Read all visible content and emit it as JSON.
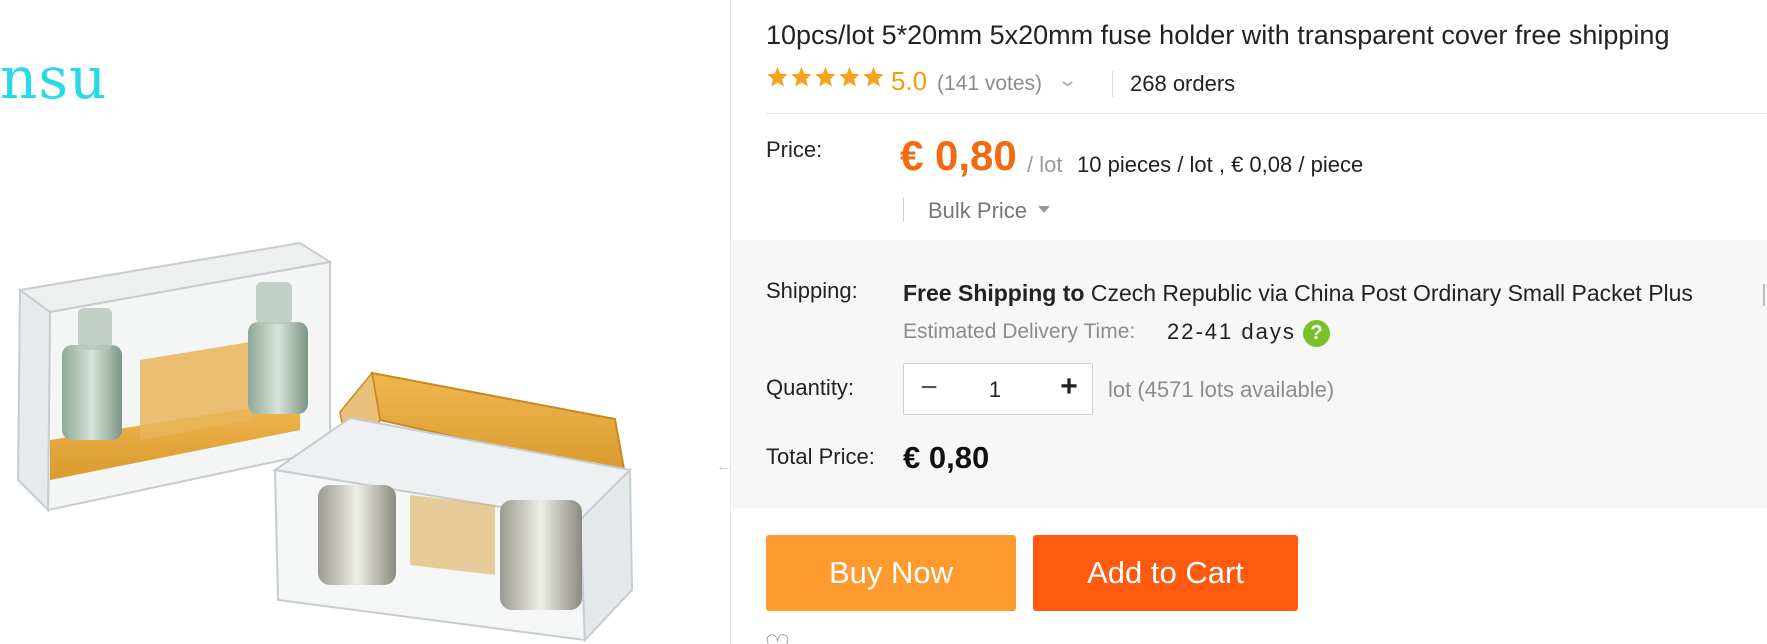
{
  "image": {
    "brand_watermark": "nsu",
    "arrow": "←",
    "alt_icon": "fuse-holder-photo"
  },
  "product": {
    "title": "10pcs/lot 5*20mm 5x20mm fuse holder with transparent cover free shipping",
    "rating": {
      "stars": 5,
      "value": "5.0",
      "votes": "(141 votes)",
      "chevron": "⌄"
    },
    "orders": "268 orders"
  },
  "price": {
    "label": "Price:",
    "value": "€ 0,80",
    "unit": "/ lot",
    "detail": "10 pieces / lot , € 0,08 / piece",
    "bulk_label": "Bulk Price"
  },
  "shipping": {
    "label": "Shipping:",
    "free_text": "Free Shipping",
    "to_text": "to",
    "destination_text": "Czech Republic via China Post Ordinary Small Packet Plus",
    "delivery_label": "Estimated Delivery Time:",
    "delivery_value": "22-41 days",
    "help_icon": "?"
  },
  "quantity": {
    "label": "Quantity:",
    "minus": "−",
    "value": "1",
    "plus": "+",
    "available": "lot (4571 lots available)"
  },
  "total": {
    "label": "Total Price:",
    "value": "€ 0,80"
  },
  "actions": {
    "buy_now": "Buy Now",
    "add_to_cart": "Add to Cart",
    "wishlist_icon": "♡"
  },
  "colors": {
    "price_accent": "#f36a11",
    "star": "#f7a21b",
    "buy_now_bg": "#ff9a2e",
    "add_to_cart_bg": "#ff5a0d",
    "help_icon_bg": "#7bbf2a",
    "watermark": "#29d9e6"
  }
}
